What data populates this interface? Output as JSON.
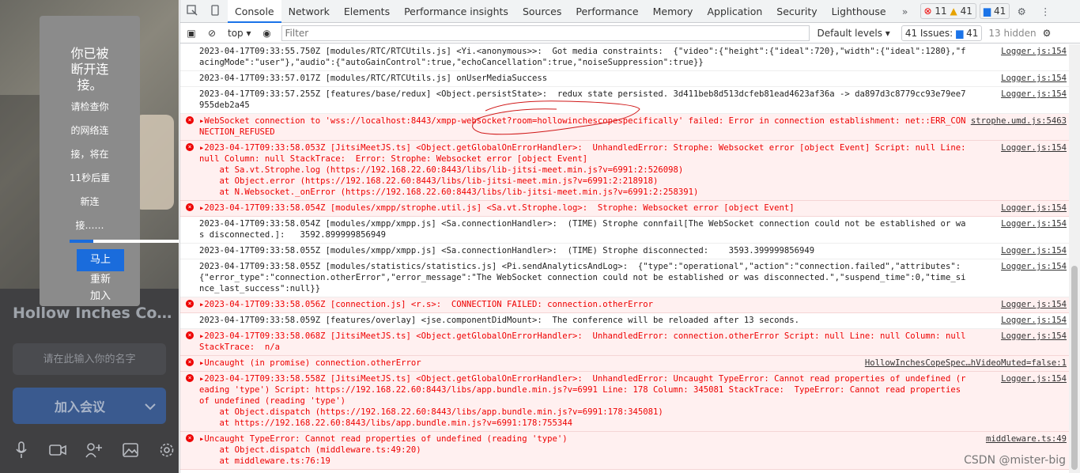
{
  "meeting": {
    "room_title": "Hollow Inches Co…",
    "name_placeholder": "请在此输入你的名字",
    "join_label": "加入会议",
    "dialog": {
      "title": "你已被断开连接。",
      "line1": "请检查你",
      "line2": "的网络连",
      "line3": "接，将在",
      "line4": "11秒后重",
      "line5": "新连",
      "line6": "接……",
      "reconnect1": "马上",
      "reconnect2": "重新",
      "reconnect3": "加入"
    },
    "progress_fraction": 0.2
  },
  "devtools": {
    "tabs": [
      "Console",
      "Network",
      "Elements",
      "Performance insights",
      "Sources",
      "Performance",
      "Memory",
      "Application",
      "Security",
      "Lighthouse"
    ],
    "errors_count": "11",
    "warnings_count": "41",
    "messages_count": "41",
    "context": "top",
    "filter_placeholder": "Filter",
    "levels": "Default levels",
    "issues": "41 Issues:",
    "issues_count": "41",
    "hidden": "13 hidden",
    "watermark": "CSDN @mister-big"
  },
  "console": [
    {
      "type": "log",
      "text": "2023-04-17T09:33:55.750Z [modules/RTC/RTCUtils.js] <Yi.<anonymous>>:  Got media constraints:  {\"video\":{\"height\":{\"ideal\":720},\"width\":{\"ideal\":1280},\"facingMode\":\"user\"},\"audio\":{\"autoGainControl\":true,\"echoCancellation\":true,\"noiseSuppression\":true}}",
      "src": "Logger.js:154"
    },
    {
      "type": "log",
      "text": "2023-04-17T09:33:57.017Z [modules/RTC/RTCUtils.js] onUserMediaSuccess",
      "src": "Logger.js:154"
    },
    {
      "type": "log",
      "text": "2023-04-17T09:33:57.255Z [features/base/redux] <Object.persistState>:  redux state persisted. 3d411beb8d513dcfeb81ead4623af36a -> da897d3c8779cc93e79ee7955deb2a45",
      "src": "Logger.js:154"
    },
    {
      "type": "err",
      "text": "▸WebSocket connection to 'wss://localhost:8443/xmpp-websocket?room=hollowinchescopespecifically' failed: Error in connection establishment: net::ERR_CONNECTION_REFUSED",
      "src": "strophe.umd.js:5463"
    },
    {
      "type": "err",
      "text": "▸2023-04-17T09:33:58.053Z [JitsiMeetJS.ts] <Object.getGlobalOnErrorHandler>:  UnhandledError: Strophe: Websocket error [object Event] Script: null Line: null Column: null StackTrace:  Error: Strophe: Websocket error [object Event]\n    at Sa.vt.Strophe.log (https://192.168.22.60:8443/libs/lib-jitsi-meet.min.js?v=6991:2:526098)\n    at Object.error (https://192.168.22.60:8443/libs/lib-jitsi-meet.min.js?v=6991:2:218918)\n    at N.Websocket._onError (https://192.168.22.60:8443/libs/lib-jitsi-meet.min.js?v=6991:2:258391)",
      "src": "Logger.js:154"
    },
    {
      "type": "err",
      "text": "▸2023-04-17T09:33:58.054Z [modules/xmpp/strophe.util.js] <Sa.vt.Strophe.log>:  Strophe: Websocket error [object Event]",
      "src": "Logger.js:154"
    },
    {
      "type": "log",
      "text": "2023-04-17T09:33:58.054Z [modules/xmpp/xmpp.js] <Sa.connectionHandler>:  (TIME) Strophe connfail[The WebSocket connection could not be established or was disconnected.]:   3592.899999856949",
      "src": "Logger.js:154"
    },
    {
      "type": "log",
      "text": "2023-04-17T09:33:58.055Z [modules/xmpp/xmpp.js] <Sa.connectionHandler>:  (TIME) Strophe disconnected:    3593.399999856949",
      "src": "Logger.js:154"
    },
    {
      "type": "log",
      "text": "2023-04-17T09:33:58.055Z [modules/statistics/statistics.js] <Pi.sendAnalyticsAndLog>:  {\"type\":\"operational\",\"action\":\"connection.failed\",\"attributes\":{\"error_type\":\"connection.otherError\",\"error_message\":\"The WebSocket connection could not be established or was disconnected.\",\"suspend_time\":0,\"time_since_last_success\":null}}",
      "src": "Logger.js:154"
    },
    {
      "type": "err",
      "text": "▸2023-04-17T09:33:58.056Z [connection.js] <r.s>:  CONNECTION FAILED: connection.otherError",
      "src": "Logger.js:154"
    },
    {
      "type": "log",
      "text": "2023-04-17T09:33:58.059Z [features/overlay] <jse.componentDidMount>:  The conference will be reloaded after 13 seconds.",
      "src": "Logger.js:154"
    },
    {
      "type": "err",
      "text": "▸2023-04-17T09:33:58.068Z [JitsiMeetJS.ts] <Object.getGlobalOnErrorHandler>:  UnhandledError: connection.otherError Script: null Line: null Column: null StackTrace:  n/a",
      "src": "Logger.js:154"
    },
    {
      "type": "err",
      "text": "▸Uncaught (in promise) connection.otherError",
      "src": "HollowInchesCopeSpec…hVideoMuted=false:1"
    },
    {
      "type": "err",
      "text": "▸2023-04-17T09:33:58.558Z [JitsiMeetJS.ts] <Object.getGlobalOnErrorHandler>:  UnhandledError: Uncaught TypeError: Cannot read properties of undefined (reading 'type') Script: https://192.168.22.60:8443/libs/app.bundle.min.js?v=6991 Line: 178 Column: 345081 StackTrace:  TypeError: Cannot read properties of undefined (reading 'type')\n    at Object.dispatch (https://192.168.22.60:8443/libs/app.bundle.min.js?v=6991:178:345081)\n    at https://192.168.22.60:8443/libs/app.bundle.min.js?v=6991:178:755344",
      "src": "Logger.js:154"
    },
    {
      "type": "err",
      "text": "▸Uncaught TypeError: Cannot read properties of undefined (reading 'type')\n    at Object.dispatch (middleware.ts:49:20)\n    at middleware.ts:76:19",
      "src": "middleware.ts:49"
    }
  ]
}
